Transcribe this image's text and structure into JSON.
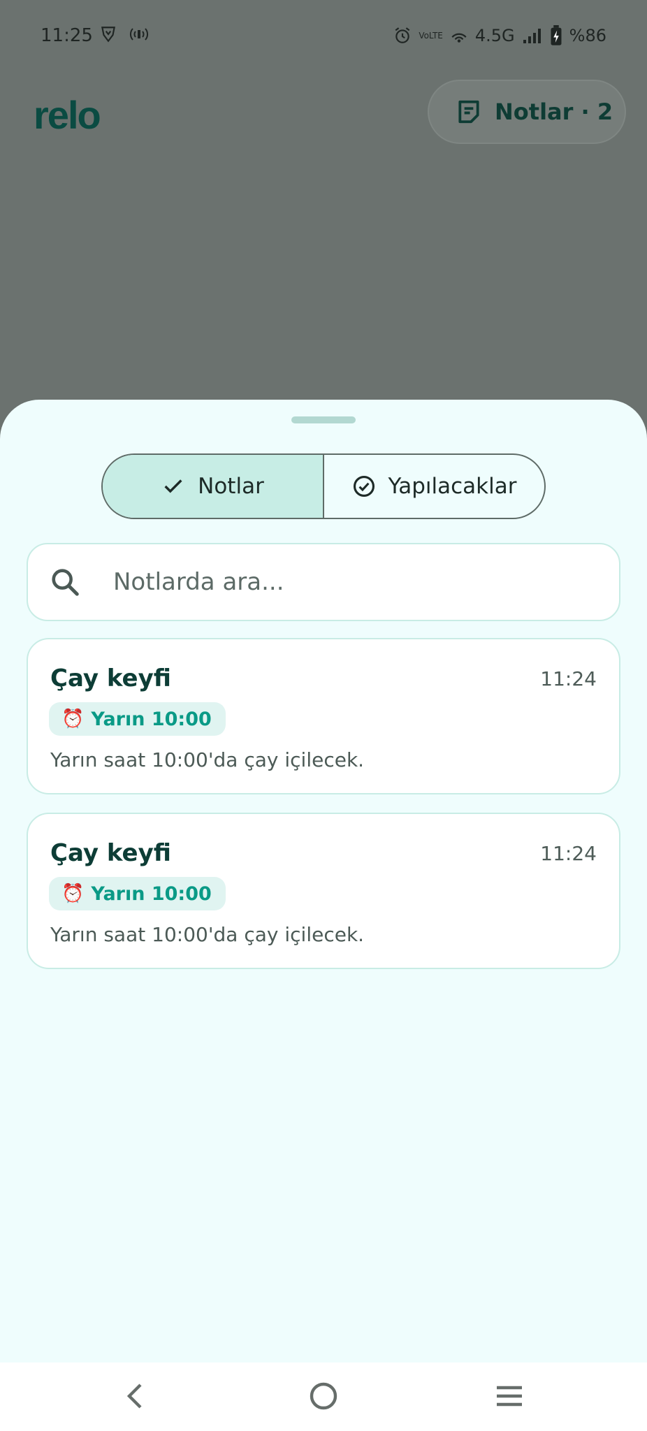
{
  "status_bar": {
    "time": "11:25",
    "network": "4.5G",
    "volte": "VoLTE",
    "battery": "%86"
  },
  "header": {
    "logo": "relo",
    "notes_button_label": "Notlar · 2"
  },
  "sheet": {
    "tabs": [
      {
        "label": "Notlar",
        "active": true
      },
      {
        "label": "Yapılacaklar",
        "active": false
      }
    ],
    "search_placeholder": "Notlarda ara...",
    "notes": [
      {
        "title": "Çay keyfi",
        "time": "11:24",
        "reminder": "Yarın 10:00",
        "body": "Yarın saat 10:00'da çay içilecek."
      },
      {
        "title": "Çay keyfi",
        "time": "11:24",
        "reminder": "Yarın 10:00",
        "body": "Yarın saat 10:00'da çay içilecek."
      }
    ]
  },
  "colors": {
    "scrim": "#6b726f",
    "sheet_bg": "#effdfd",
    "accent": "#0a9a86",
    "active_tab": "#c7ede5",
    "alarm": "#d23b2f"
  }
}
